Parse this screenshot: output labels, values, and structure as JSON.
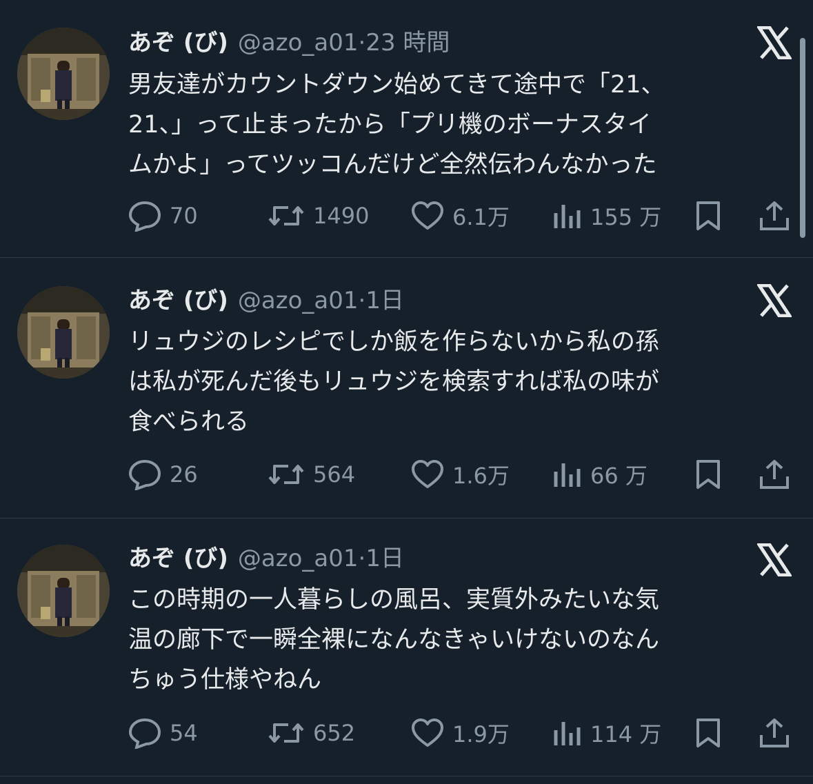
{
  "tweets": [
    {
      "name": "あぞ (び)",
      "handle": "@azo_a01",
      "sep": "·",
      "time": "23 時間",
      "lines": [
        "男友達がカウントダウン始めてきて途中で「21、",
        "21、」って止まったから「プリ機のボーナスタイ",
        "ムかよ」ってツッコんだけど全然伝わんなかった"
      ],
      "replies": "70",
      "retweets": "1490",
      "likes": "6.1万",
      "views": "155 万"
    },
    {
      "name": "あぞ (び)",
      "handle": "@azo_a01",
      "sep": "·",
      "time": "1日",
      "lines": [
        "リュウジのレシピでしか飯を作らないから私の孫",
        "は私が死んだ後もリュウジを検索すれば私の味が",
        "食べられる"
      ],
      "replies": "26",
      "retweets": "564",
      "likes": "1.6万",
      "views": "66 万"
    },
    {
      "name": "あぞ (び)",
      "handle": "@azo_a01",
      "sep": "·",
      "time": "1日",
      "lines": [
        "この時期の一人暮らしの風呂、実質外みたいな気",
        "温の廊下で一瞬全裸になんなきゃいけないのなん",
        "ちゅう仕様やねん"
      ],
      "replies": "54",
      "retweets": "652",
      "likes": "1.9万",
      "views": "114 万"
    }
  ],
  "icons": {
    "reply": "speech-bubble-icon",
    "retweet": "retweet-arrows-icon",
    "like": "heart-icon",
    "views": "bar-chart-icon",
    "bookmark": "bookmark-icon",
    "share": "upload-share-icon",
    "brand": "x-logo-icon"
  },
  "colors": {
    "background": "#15202b",
    "text": "#e7e9ea",
    "muted": "#8b98a5",
    "divider": "#2f3b47"
  }
}
